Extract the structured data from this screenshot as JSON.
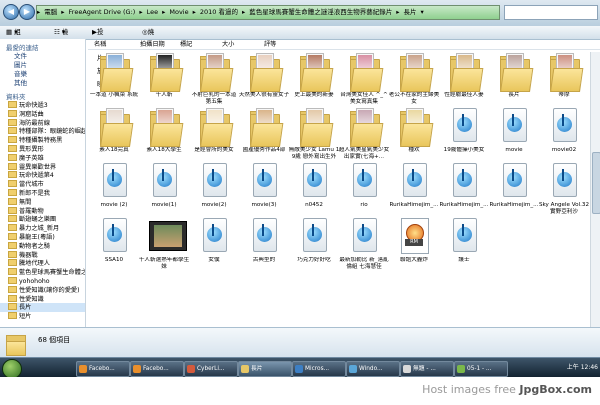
{
  "address": {
    "crumbs": [
      "電腦",
      "FreeAgent Drive (G:)",
      "Lee",
      "Movie",
      "2010 看過的",
      "藍色星球馬賽蟹生命體之謎淫浪西生物界藝紀錄片",
      "長片"
    ]
  },
  "toolbar": {
    "organize": "組合管理",
    "views": "檢視",
    "slideshow": "投影片放映",
    "burn": "燒錄"
  },
  "sidebar": {
    "favorites_title": "最愛的連結",
    "links": [
      "文件",
      "圖片",
      "音樂",
      "其他"
    ],
    "folders_title": "資料夾",
    "tree": [
      {
        "label": "玩命快遞3",
        "selected": false
      },
      {
        "label": "洞窟話曲",
        "selected": false
      },
      {
        "label": "海防最前線",
        "selected": false
      },
      {
        "label": "特種部隊：眼鏡蛇的崛起",
        "selected": false
      },
      {
        "label": "特種攝製特務黑",
        "selected": false
      },
      {
        "label": "異形異形",
        "selected": false
      },
      {
        "label": "魔子英雄",
        "selected": false
      },
      {
        "label": "靈異樂歡世界",
        "selected": false
      },
      {
        "label": "玩命快遞第4",
        "selected": false
      },
      {
        "label": "當代城市",
        "selected": false
      },
      {
        "label": "新郎不是我",
        "selected": false
      },
      {
        "label": "無間",
        "selected": false
      },
      {
        "label": "普羅動物",
        "selected": false
      },
      {
        "label": "斷翅蛹之樂團",
        "selected": false
      },
      {
        "label": "暴力之城_新月",
        "selected": false
      },
      {
        "label": "暴龍王(粵語)",
        "selected": false
      },
      {
        "label": "動物者之騎",
        "selected": false
      },
      {
        "label": "機器戰",
        "selected": false
      },
      {
        "label": "騰地代理人",
        "selected": false
      },
      {
        "label": "藍色星球馬賽蟹生命體之謎",
        "selected": false
      },
      {
        "label": "yohohoho",
        "selected": false
      },
      {
        "label": "性愛知識(讓你的愛愛)",
        "selected": false
      },
      {
        "label": "性愛知識",
        "selected": false
      },
      {
        "label": "長片",
        "selected": true
      },
      {
        "label": "短片",
        "selected": false
      }
    ]
  },
  "columns": [
    "名稱",
    "拍攝日期",
    "標記",
    "大小",
    "評等"
  ],
  "files": [
    {
      "name": "一本道 小楓菜 系統",
      "type": "folder",
      "thumb": "#8ab0d8"
    },
    {
      "name": "千人斬",
      "type": "folder",
      "thumb": "#222222"
    },
    {
      "name": "不射巨乳的一本道 第五集",
      "type": "folder",
      "thumb": "#c49a85"
    },
    {
      "name": "天然美人很有靈女子",
      "type": "folder",
      "thumb": "#e8d0c0"
    },
    {
      "name": "史上最美的新妻",
      "type": "folder",
      "thumb": "#b57a63"
    },
    {
      "name": "台灣美女佳人 ^_^ 美女寫真集",
      "type": "folder",
      "thumb": "#d88fa3"
    },
    {
      "name": "老公不在家的主婦美女",
      "type": "folder",
      "thumb": "#caa38a"
    },
    {
      "name": "性經驗最佳人妻",
      "type": "folder",
      "thumb": "#d9b98a"
    },
    {
      "name": "長片",
      "type": "folder",
      "thumb": "#bca39c"
    },
    {
      "name": "蒂摩",
      "type": "folder",
      "thumb": "#cc8f80"
    },
    {
      "name": "素人18完真",
      "type": "folder",
      "thumb": "#e6dad0"
    },
    {
      "name": "素人18大學生",
      "type": "folder",
      "thumb": "#d9a492"
    },
    {
      "name": "是經會所的美女",
      "type": "folder",
      "thumb": "#f1e2c8"
    },
    {
      "name": "國產優秀作品4部",
      "type": "folder",
      "thumb": "#d9b48a"
    },
    {
      "name": "無敵美少女 Lamu 19歲 戀外寫出生外",
      "type": "folder",
      "thumb": "#e3c9a8"
    },
    {
      "name": "超人氣美星氣美少女出家實(七海+...",
      "type": "folder",
      "thumb": "#c8a8b4"
    },
    {
      "name": "種欢",
      "type": "folder",
      "thumb": "#ead8a0"
    },
    {
      "name": "19歲體操小美女",
      "type": "media"
    },
    {
      "name": "movie",
      "type": "media"
    },
    {
      "name": "movie02",
      "type": "media"
    },
    {
      "name": "movie (2)",
      "type": "media"
    },
    {
      "name": "movie(1)",
      "type": "media"
    },
    {
      "name": "movie(2)",
      "type": "media"
    },
    {
      "name": "movie(3)",
      "type": "media"
    },
    {
      "name": "n0452",
      "type": "media"
    },
    {
      "name": "rio",
      "type": "media"
    },
    {
      "name": "RurikaHimejim_...",
      "type": "media"
    },
    {
      "name": "RurikaHimejim_...",
      "type": "media"
    },
    {
      "name": "RurikaHimejim_...",
      "type": "media"
    },
    {
      "name": "Sky Angele Vol.32 實野亞利沙",
      "type": "media"
    },
    {
      "name": "SSA10",
      "type": "media"
    },
    {
      "name": "千人斬選熟年都學生妹",
      "type": "film"
    },
    {
      "name": "女僕",
      "type": "media"
    },
    {
      "name": "古典型的",
      "type": "media"
    },
    {
      "name": "巧克力好好吃",
      "type": "media"
    },
    {
      "name": "最新加勒比 新_落亂倫組 七海慧佳",
      "type": "media"
    },
    {
      "name": "聯誼大轟炸",
      "type": "rm"
    },
    {
      "name": "護士",
      "type": "media"
    }
  ],
  "status": {
    "count_text": "68 個項目"
  },
  "taskbar": {
    "items": [
      {
        "label": "Facebo...",
        "color": "#e98f2c"
      },
      {
        "label": "Facebo...",
        "color": "#e98f2c"
      },
      {
        "label": "CyberLi...",
        "color": "#d45a3c"
      },
      {
        "label": "長片",
        "color": "#e7c767"
      },
      {
        "label": "Micros...",
        "color": "#3d7fc4"
      },
      {
        "label": "Windo...",
        "color": "#5aa6d8"
      },
      {
        "label": "無題 - ...",
        "color": "#d9d9d9"
      },
      {
        "label": "05-1 - ...",
        "color": "#7ab84a"
      }
    ],
    "active_index": 3,
    "clock": "上午 12:46"
  },
  "footer": {
    "prefix": "Host images free ",
    "brand": "JpgBox.com"
  }
}
